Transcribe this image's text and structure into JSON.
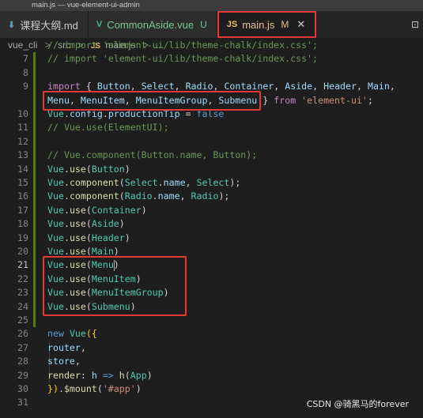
{
  "window": {
    "title": "main.js — vue-element-ui-admin"
  },
  "tabs": [
    {
      "icon": "markdown-icon",
      "icon_glyph": "⬇",
      "icon_color": "#519aba",
      "label": "课程大纲.md",
      "label_color": "#cccccc",
      "status": "",
      "active": false
    },
    {
      "icon": "vue-icon",
      "icon_glyph": "V",
      "icon_color": "#41b883",
      "label": "CommonAside.vue",
      "label_color": "#73c991",
      "status": "U",
      "status_color": "#73c991",
      "active": false
    },
    {
      "icon": "js-icon",
      "icon_glyph": "JS",
      "icon_color": "#e5c06a",
      "label": "main.js",
      "label_color": "#e2c08d",
      "status": "M",
      "status_color": "#e2c08d",
      "active": true,
      "close": "✕"
    }
  ],
  "breadcrumb": {
    "items": [
      "vue_cli",
      "src",
      "main.js",
      "..."
    ],
    "separator": ">"
  },
  "code": {
    "lines": [
      {
        "num": "",
        "top_partial": true,
        "tokens": [
          [
            "t-cm",
            "// import 'element-ui/lib/theme-chalk/index.css';"
          ]
        ]
      },
      {
        "num": "7",
        "tokens": [
          [
            "t-cm",
            "// import 'element-ui/lib/theme-chalk/index.css';"
          ]
        ]
      },
      {
        "num": "8",
        "tokens": []
      },
      {
        "num": "9",
        "tokens": [
          [
            "t-kw2",
            "import"
          ],
          [
            "t-p",
            " { "
          ],
          [
            "t-var",
            "Button"
          ],
          [
            "t-p",
            ", "
          ],
          [
            "t-var",
            "Select"
          ],
          [
            "t-p",
            ", "
          ],
          [
            "t-var",
            "Radio"
          ],
          [
            "t-p",
            ", "
          ],
          [
            "t-var",
            "Container"
          ],
          [
            "t-p",
            ", "
          ],
          [
            "t-var",
            "Aside"
          ],
          [
            "t-p",
            ", "
          ],
          [
            "t-var",
            "Header"
          ],
          [
            "t-p",
            ", "
          ],
          [
            "t-var",
            "Main"
          ],
          [
            "t-p",
            ","
          ]
        ]
      },
      {
        "num": "",
        "tokens": [
          [
            "t-var",
            "Menu"
          ],
          [
            "t-p",
            ", "
          ],
          [
            "t-var",
            "MenuItem"
          ],
          [
            "t-p",
            ", "
          ],
          [
            "t-var",
            "MenuItemGroup"
          ],
          [
            "t-p",
            ", "
          ],
          [
            "t-var",
            "Submenu"
          ],
          [
            "t-p",
            " } "
          ],
          [
            "t-kw2",
            "from"
          ],
          [
            "t-p",
            " "
          ],
          [
            "t-str",
            "'element-ui'"
          ],
          [
            "t-p",
            ";"
          ]
        ]
      },
      {
        "num": "10",
        "tokens": [
          [
            "t-cls",
            "Vue"
          ],
          [
            "t-p",
            "."
          ],
          [
            "t-var",
            "config"
          ],
          [
            "t-p",
            "."
          ],
          [
            "t-var",
            "productionTip"
          ],
          [
            "t-p",
            " = "
          ],
          [
            "t-kw",
            "false"
          ]
        ]
      },
      {
        "num": "11",
        "tokens": [
          [
            "t-cm",
            "// Vue.use(ElementUI);"
          ]
        ]
      },
      {
        "num": "12",
        "tokens": []
      },
      {
        "num": "13",
        "tokens": [
          [
            "t-cm",
            "// Vue.component(Button.name, Button);"
          ]
        ]
      },
      {
        "num": "14",
        "tokens": [
          [
            "t-cls",
            "Vue"
          ],
          [
            "t-p",
            "."
          ],
          [
            "t-fn",
            "use"
          ],
          [
            "t-p",
            "("
          ],
          [
            "t-cls",
            "Button"
          ],
          [
            "t-p",
            ")"
          ]
        ]
      },
      {
        "num": "15",
        "tokens": [
          [
            "t-cls",
            "Vue"
          ],
          [
            "t-p",
            "."
          ],
          [
            "t-fn",
            "component"
          ],
          [
            "t-p",
            "("
          ],
          [
            "t-cls",
            "Select"
          ],
          [
            "t-p",
            "."
          ],
          [
            "t-var",
            "name"
          ],
          [
            "t-p",
            ", "
          ],
          [
            "t-cls",
            "Select"
          ],
          [
            "t-p",
            ");"
          ]
        ]
      },
      {
        "num": "16",
        "tokens": [
          [
            "t-cls",
            "Vue"
          ],
          [
            "t-p",
            "."
          ],
          [
            "t-fn",
            "component"
          ],
          [
            "t-p",
            "("
          ],
          [
            "t-cls",
            "Radio"
          ],
          [
            "t-p",
            "."
          ],
          [
            "t-var",
            "name"
          ],
          [
            "t-p",
            ", "
          ],
          [
            "t-cls",
            "Radio"
          ],
          [
            "t-p",
            ");"
          ]
        ]
      },
      {
        "num": "17",
        "tokens": [
          [
            "t-cls",
            "Vue"
          ],
          [
            "t-p",
            "."
          ],
          [
            "t-fn",
            "use"
          ],
          [
            "t-p",
            "("
          ],
          [
            "t-cls",
            "Container"
          ],
          [
            "t-p",
            ")"
          ]
        ]
      },
      {
        "num": "18",
        "tokens": [
          [
            "t-cls",
            "Vue"
          ],
          [
            "t-p",
            "."
          ],
          [
            "t-fn",
            "use"
          ],
          [
            "t-p",
            "("
          ],
          [
            "t-cls",
            "Aside"
          ],
          [
            "t-p",
            ")"
          ]
        ]
      },
      {
        "num": "19",
        "tokens": [
          [
            "t-cls",
            "Vue"
          ],
          [
            "t-p",
            "."
          ],
          [
            "t-fn",
            "use"
          ],
          [
            "t-p",
            "("
          ],
          [
            "t-cls",
            "Header"
          ],
          [
            "t-p",
            ")"
          ]
        ]
      },
      {
        "num": "20",
        "tokens": [
          [
            "t-cls",
            "Vue"
          ],
          [
            "t-p",
            "."
          ],
          [
            "t-fn",
            "use"
          ],
          [
            "t-p",
            "("
          ],
          [
            "t-cls",
            "Main"
          ],
          [
            "t-p",
            ")"
          ]
        ]
      },
      {
        "num": "21",
        "current": true,
        "tokens": [
          [
            "t-cls",
            "Vue"
          ],
          [
            "t-p",
            "."
          ],
          [
            "t-fn",
            "use"
          ],
          [
            "t-p",
            "("
          ],
          [
            "t-cls",
            "Menu"
          ],
          [
            "t-p",
            ")"
          ]
        ]
      },
      {
        "num": "22",
        "tokens": [
          [
            "t-cls",
            "Vue"
          ],
          [
            "t-p",
            "."
          ],
          [
            "t-fn",
            "use"
          ],
          [
            "t-p",
            "("
          ],
          [
            "t-cls",
            "MenuItem"
          ],
          [
            "t-p",
            ")"
          ]
        ]
      },
      {
        "num": "23",
        "tokens": [
          [
            "t-cls",
            "Vue"
          ],
          [
            "t-p",
            "."
          ],
          [
            "t-fn",
            "use"
          ],
          [
            "t-p",
            "("
          ],
          [
            "t-cls",
            "MenuItemGroup"
          ],
          [
            "t-p",
            ")"
          ]
        ]
      },
      {
        "num": "24",
        "tokens": [
          [
            "t-cls",
            "Vue"
          ],
          [
            "t-p",
            "."
          ],
          [
            "t-fn",
            "use"
          ],
          [
            "t-p",
            "("
          ],
          [
            "t-cls",
            "Submenu"
          ],
          [
            "t-p",
            ")"
          ]
        ]
      },
      {
        "num": "25",
        "tokens": []
      },
      {
        "num": "26",
        "tokens": [
          [
            "t-kw",
            "new"
          ],
          [
            "t-p",
            " "
          ],
          [
            "t-cls",
            "Vue"
          ],
          [
            "t-br",
            "({"
          ]
        ]
      },
      {
        "num": "27",
        "indent": true,
        "tokens": [
          [
            "t-p",
            "  "
          ],
          [
            "t-var",
            "router"
          ],
          [
            "t-p",
            ","
          ]
        ]
      },
      {
        "num": "28",
        "indent": true,
        "tokens": [
          [
            "t-p",
            "  "
          ],
          [
            "t-var",
            "store"
          ],
          [
            "t-p",
            ","
          ]
        ]
      },
      {
        "num": "29",
        "indent": true,
        "tokens": [
          [
            "t-p",
            "  "
          ],
          [
            "t-fn",
            "render"
          ],
          [
            "t-p",
            ": "
          ],
          [
            "t-var",
            "h"
          ],
          [
            "t-p",
            " "
          ],
          [
            "t-kw",
            "=>"
          ],
          [
            "t-p",
            " "
          ],
          [
            "t-fn",
            "h"
          ],
          [
            "t-p",
            "("
          ],
          [
            "t-cls",
            "App"
          ],
          [
            "t-p",
            ")"
          ]
        ]
      },
      {
        "num": "30",
        "tokens": [
          [
            "t-br",
            "})"
          ],
          [
            "t-p",
            "."
          ],
          [
            "t-fn",
            "$mount"
          ],
          [
            "t-p",
            "("
          ],
          [
            "t-str",
            "'#app'"
          ],
          [
            "t-p",
            ")"
          ]
        ]
      },
      {
        "num": "31",
        "tokens": []
      }
    ]
  },
  "watermark": "CSDN @骑黑马的forever",
  "accent_colors": {
    "highlight_box": "#e53935",
    "modified_bar": "#587c0c",
    "editor_bg": "#1e1e1e"
  }
}
